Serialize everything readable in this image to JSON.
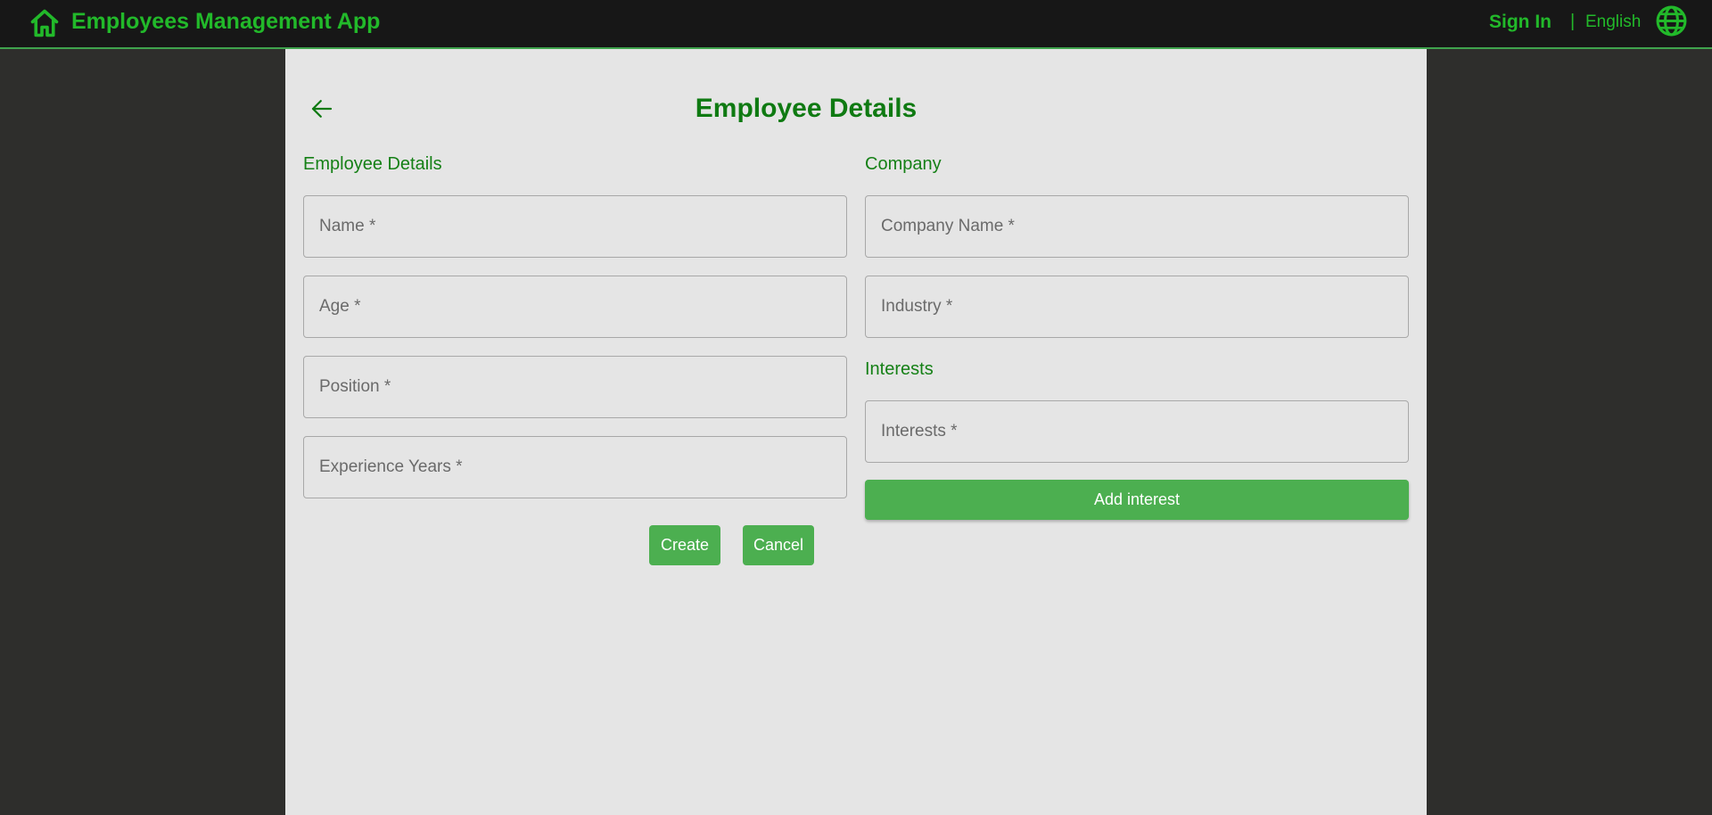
{
  "header": {
    "title": "Employees Management App",
    "sign_in": "Sign In",
    "separator": "|",
    "language": "English",
    "home_icon": "home-icon",
    "globe_icon": "globe-icon"
  },
  "page": {
    "title": "Employee Details",
    "back_icon": "arrow-left-icon"
  },
  "employee_section": {
    "label": "Employee Details",
    "fields": {
      "name": {
        "placeholder": "Name *",
        "value": ""
      },
      "age": {
        "placeholder": "Age *",
        "value": ""
      },
      "position": {
        "placeholder": "Position *",
        "value": ""
      },
      "experience": {
        "placeholder": "Experience Years *",
        "value": ""
      }
    }
  },
  "company_section": {
    "label": "Company",
    "fields": {
      "company_name": {
        "placeholder": "Company Name *",
        "value": ""
      },
      "industry": {
        "placeholder": "Industry *",
        "value": ""
      }
    }
  },
  "interests_section": {
    "label": "Interests",
    "field": {
      "placeholder": "Interests *",
      "value": ""
    },
    "add_button": "Add interest"
  },
  "actions": {
    "create": "Create",
    "cancel": "Cancel"
  },
  "colors": {
    "accent": "#22b92a",
    "title_green": "#0f7a12",
    "button_green": "#4caf50",
    "topbar": "#171717",
    "background": "#2e2e2c",
    "panel": "#e5e5e5"
  }
}
